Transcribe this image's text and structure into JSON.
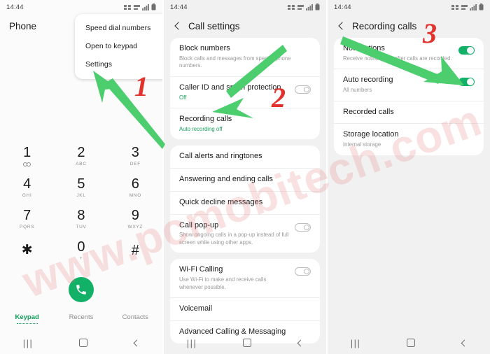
{
  "watermark": "www.pcmobitech.com",
  "colors": {
    "accent_green": "#12b167",
    "arrow_green": "#4ccd6e",
    "marker_red": "#e3312b",
    "panel_bg": "#f1f1f1",
    "card_bg": "#ffffff"
  },
  "panel1": {
    "status": {
      "clock": "14:44",
      "icons": [
        "signal-icon",
        "lte-icon",
        "bars-icon",
        "battery-icon"
      ]
    },
    "app_title": "Phone",
    "menu": {
      "items": [
        {
          "label": "Speed dial numbers"
        },
        {
          "label": "Open to keypad"
        },
        {
          "label": "Settings"
        }
      ]
    },
    "keypad": [
      {
        "digit": "1",
        "sub": "",
        "voicemail": true
      },
      {
        "digit": "2",
        "sub": "ABC"
      },
      {
        "digit": "3",
        "sub": "DEF"
      },
      {
        "digit": "4",
        "sub": "GHI"
      },
      {
        "digit": "5",
        "sub": "JKL"
      },
      {
        "digit": "6",
        "sub": "MNO"
      },
      {
        "digit": "7",
        "sub": "PQRS"
      },
      {
        "digit": "8",
        "sub": "TUV"
      },
      {
        "digit": "9",
        "sub": "WXYZ"
      },
      {
        "digit": "✱",
        "sub": ""
      },
      {
        "digit": "0",
        "sub": "+"
      },
      {
        "digit": "#",
        "sub": ""
      }
    ],
    "call_button": "call-icon",
    "tabs": [
      {
        "label": "Keypad",
        "active": true
      },
      {
        "label": "Recents",
        "active": false
      },
      {
        "label": "Contacts",
        "active": false
      }
    ]
  },
  "panel2": {
    "status": {
      "clock": "14:44"
    },
    "app_title": "Call settings",
    "groups": [
      {
        "rows": [
          {
            "title": "Block numbers",
            "sub": "Block calls and messages from specific phone numbers.",
            "toggle": null
          },
          {
            "title": "Caller ID and spam protection",
            "sub": "Off",
            "toggle": "off"
          },
          {
            "title": "Recording calls",
            "sub": "Auto recording off",
            "sub_green": true,
            "toggle": null
          }
        ]
      },
      {
        "rows": [
          {
            "title": "Call alerts and ringtones",
            "sub": "",
            "toggle": null
          },
          {
            "title": "Answering and ending calls",
            "sub": "",
            "toggle": null
          },
          {
            "title": "Quick decline messages",
            "sub": "",
            "toggle": null
          },
          {
            "title": "Call pop-up",
            "sub": "Show ongoing calls in a pop-up instead of full screen while using other apps.",
            "toggle": "off"
          }
        ]
      },
      {
        "rows": [
          {
            "title": "Wi-Fi Calling",
            "sub": "Use Wi-Fi to make and receive calls whenever possible.",
            "toggle": "off"
          },
          {
            "title": "Voicemail",
            "sub": "",
            "toggle": null
          },
          {
            "title": "Advanced Calling & Messaging",
            "sub": "",
            "toggle": null
          }
        ]
      }
    ]
  },
  "panel3": {
    "status": {
      "clock": "14:44"
    },
    "app_title": "Recording calls",
    "groups": [
      {
        "rows": [
          {
            "title": "Notifications",
            "sub": "Receive notifications after calls are recorded.",
            "toggle": "on"
          },
          {
            "title": "Auto recording",
            "sub": "All numbers",
            "toggle": "on"
          },
          {
            "title": "Recorded calls",
            "sub": "",
            "toggle": null
          },
          {
            "title": "Storage location",
            "sub": "Internal storage",
            "toggle": null
          }
        ]
      }
    ]
  },
  "navbar": {
    "recents": "recents-icon",
    "home": "home-icon",
    "back": "back-icon"
  },
  "annotations": {
    "markers": [
      {
        "label": "1"
      },
      {
        "label": "2"
      },
      {
        "label": "3"
      }
    ],
    "arrows": [
      {
        "name": "arrow-to-settings"
      },
      {
        "name": "arrow-to-recording-calls"
      },
      {
        "name": "arrow-to-auto-recording-toggle"
      }
    ]
  }
}
